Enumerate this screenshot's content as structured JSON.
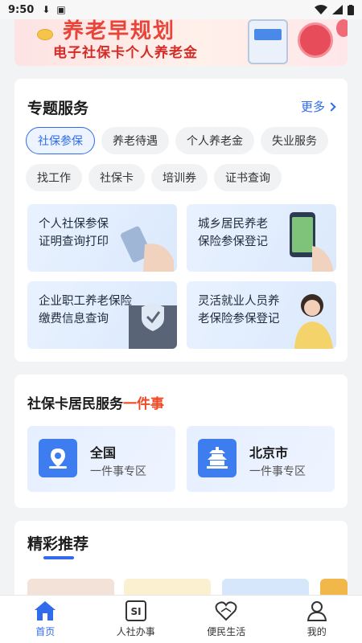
{
  "status_bar": {
    "time": "9:50"
  },
  "banner": {
    "title": "养老早规划",
    "subtitle": "电子社保卡个人养老金"
  },
  "special_services": {
    "title": "专题服务",
    "more_label": "更多",
    "chips_row1": [
      "社保参保",
      "养老待遇",
      "个人养老金",
      "失业服务"
    ],
    "chips_row2": [
      "找工作",
      "社保卡",
      "培训券",
      "证书查询"
    ],
    "active_chip": "社保参保",
    "tiles": [
      {
        "line1": "个人社保参保",
        "line2": "证明查询打印"
      },
      {
        "line1": "城乡居民养老",
        "line2": "保险参保登记"
      },
      {
        "line1": "企业职工养老保险",
        "line2": "缴费信息查询"
      },
      {
        "line1": "灵活就业人员养",
        "line2": "老保险参保登记"
      }
    ]
  },
  "one_thing": {
    "title_prefix": "社保卡居民服务",
    "title_highlight": "一件事",
    "items": [
      {
        "name": "全国",
        "sub": "一件事专区",
        "icon": "map-pin-icon"
      },
      {
        "name": "北京市",
        "sub": "一件事专区",
        "icon": "temple-icon"
      }
    ]
  },
  "recommend": {
    "title": "精彩推荐"
  },
  "bottom_nav": {
    "items": [
      {
        "label": "首页",
        "icon": "home-icon",
        "active": true
      },
      {
        "label": "人社办事",
        "icon": "si-icon",
        "active": false
      },
      {
        "label": "便民生活",
        "icon": "heart-hands-icon",
        "active": false
      },
      {
        "label": "我的",
        "icon": "user-icon",
        "active": false
      }
    ]
  },
  "colors": {
    "accent": "#2f6bea",
    "highlight": "#f04a24",
    "banner_red": "#e8443a"
  }
}
